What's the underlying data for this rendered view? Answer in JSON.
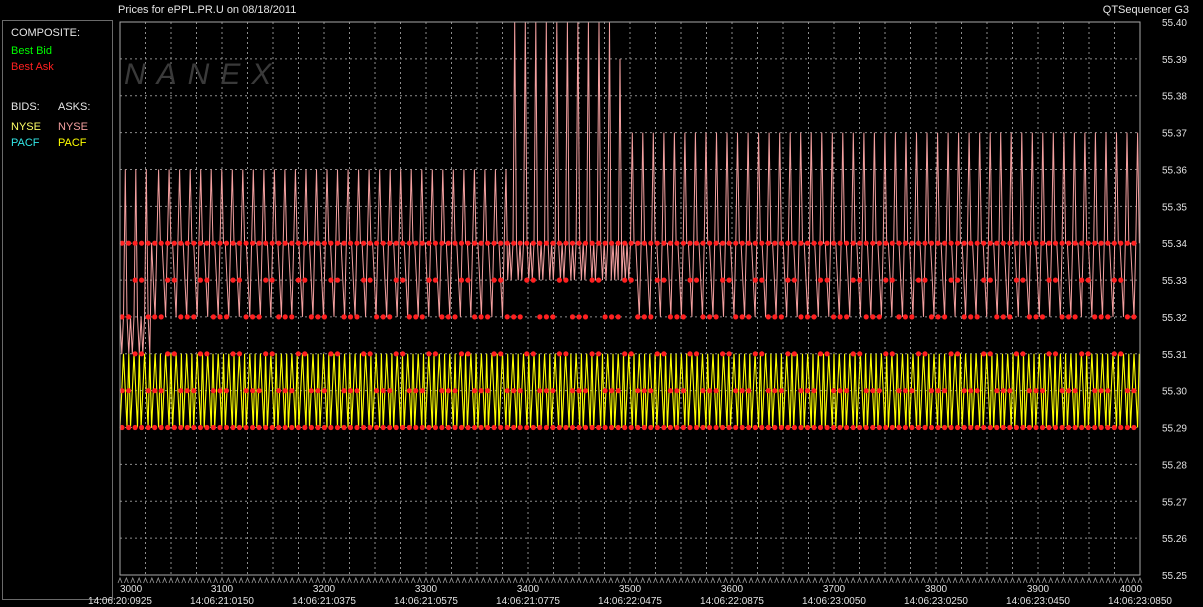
{
  "header": {
    "title_left": "Prices for  ePPL.PR.U  on  08/18/2011",
    "title_right": "QTSequencer G3"
  },
  "legend": {
    "composite_heading": "COMPOSITE:",
    "best_bid": "Best Bid",
    "best_ask": "Best Ask",
    "bids_heading": "BIDS:",
    "asks_heading": "ASKS:",
    "bid_nyse": "NYSE",
    "bid_pacf": "PACF",
    "ask_nyse": "NYSE",
    "ask_pacf": "PACF"
  },
  "watermark": "NANEX",
  "colors": {
    "best_bid": "#00ff00",
    "best_ask": "#ff2020",
    "bid_nyse": "#ffff66",
    "bid_pacf": "#33e6e6",
    "ask_nyse": "#f4a0a0",
    "ask_pacf": "#ffff00",
    "grid": "#8c8c8c",
    "frame": "#a8a8a8",
    "background": "#000000"
  },
  "chart_data": {
    "type": "line",
    "x_range": [
      3000,
      4000
    ],
    "y_range": [
      55.25,
      55.4
    ],
    "grid": true,
    "y_ticks": [
      "55.40",
      "55.39",
      "55.38",
      "55.37",
      "55.36",
      "55.35",
      "55.34",
      "55.33",
      "55.32",
      "55.31",
      "55.30",
      "55.29",
      "55.28",
      "55.27",
      "55.26",
      "55.25"
    ],
    "x_ticks": [
      "3000",
      "3100",
      "3200",
      "3300",
      "3400",
      "3500",
      "3600",
      "3700",
      "3800",
      "3900",
      "4000"
    ],
    "time_labels": [
      {
        "seq": 3000,
        "time": "14:06:20:0925"
      },
      {
        "seq": 3100,
        "time": "14:06:21:0150"
      },
      {
        "seq": 3200,
        "time": "14:06:21:0375"
      },
      {
        "seq": 3300,
        "time": "14:06:21:0575"
      },
      {
        "seq": 3400,
        "time": "14:06:21:0775"
      },
      {
        "seq": 3500,
        "time": "14:06:22:0475"
      },
      {
        "seq": 3600,
        "time": "14:06:22:0875"
      },
      {
        "seq": 3700,
        "time": "14:06:23:0050"
      },
      {
        "seq": 3800,
        "time": "14:06:23:0250"
      },
      {
        "seq": 3900,
        "time": "14:06:23:0450"
      },
      {
        "seq": 4000,
        "time": "14:06:23:0850"
      }
    ],
    "series": [
      {
        "name": "Best Ask",
        "note": "repeating quote cycle; ask segments per sequence range",
        "segments": [
          {
            "x_start": 3000,
            "x_end": 3030,
            "cycle": [
              55.32,
              55.31,
              55.32,
              55.36,
              55.32,
              55.31
            ]
          },
          {
            "x_start": 3030,
            "x_end": 3380,
            "cycle": [
              55.34,
              55.33,
              55.32,
              55.34,
              55.36,
              55.34
            ]
          },
          {
            "x_start": 3380,
            "x_end": 3480,
            "cycle": [
              55.34,
              55.33,
              55.34,
              55.4,
              55.34,
              55.33
            ]
          },
          {
            "x_start": 3480,
            "x_end": 3500,
            "cycle": [
              55.33,
              55.34,
              55.33,
              55.39,
              55.33,
              55.34
            ]
          },
          {
            "x_start": 3500,
            "x_end": 4000,
            "cycle": [
              55.34,
              55.33,
              55.32,
              55.34,
              55.37,
              55.34
            ]
          }
        ]
      },
      {
        "name": "Best Bid",
        "cycle": [
          55.29,
          55.3,
          55.31,
          55.3,
          55.29,
          55.31
        ]
      }
    ]
  }
}
